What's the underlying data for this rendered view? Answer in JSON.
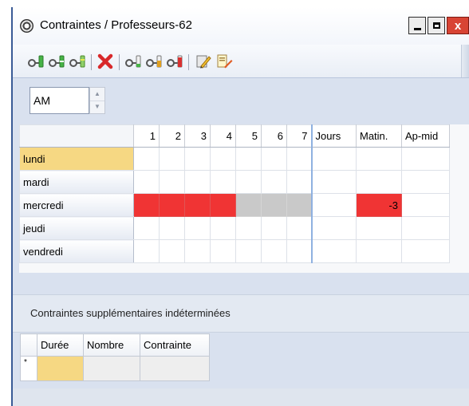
{
  "window": {
    "title": "Contraintes / Professeurs-62",
    "close_glyph": "x"
  },
  "toolbar": {
    "buttons": [
      {
        "icon": "key-green-icon"
      },
      {
        "icon": "key-green-2-icon"
      },
      {
        "icon": "key-green-3-icon"
      },
      {
        "icon": "delete-red-x-icon"
      },
      {
        "icon": "key-level-1-icon"
      },
      {
        "icon": "key-level-2-icon"
      },
      {
        "icon": "key-level-3-icon"
      },
      {
        "icon": "edit-pencil-icon"
      },
      {
        "icon": "comment-pen-icon"
      }
    ]
  },
  "period_selector": {
    "value": "AM"
  },
  "grid": {
    "columns": [
      "1",
      "2",
      "3",
      "4",
      "5",
      "6",
      "7",
      "Jours",
      "Matin.",
      "Ap-mid"
    ],
    "rows": [
      {
        "label": "lundi",
        "cells": [
          "",
          "",
          "",
          "",
          "",
          "",
          "",
          "",
          "",
          ""
        ]
      },
      {
        "label": "mardi",
        "cells": [
          "",
          "",
          "",
          "",
          "",
          "",
          "",
          "",
          "",
          ""
        ]
      },
      {
        "label": "mercredi",
        "cells": [
          "",
          "",
          "",
          "",
          "",
          "",
          "",
          "",
          "-3",
          ""
        ]
      },
      {
        "label": "jeudi",
        "cells": [
          "",
          "",
          "",
          "",
          "",
          "",
          "",
          "",
          "",
          ""
        ]
      },
      {
        "label": "vendredi",
        "cells": [
          "",
          "",
          "",
          "",
          "",
          "",
          "",
          "",
          "",
          ""
        ]
      }
    ],
    "colors": {
      "red": "#f03434",
      "grey": "#c9c9c9",
      "selected": "#f6d883"
    }
  },
  "section": {
    "label": "Contraintes supplémentaires indéterminées"
  },
  "extra_grid": {
    "columns": [
      "Durée",
      "Nombre",
      "Contrainte"
    ],
    "new_row_marker": "*"
  }
}
